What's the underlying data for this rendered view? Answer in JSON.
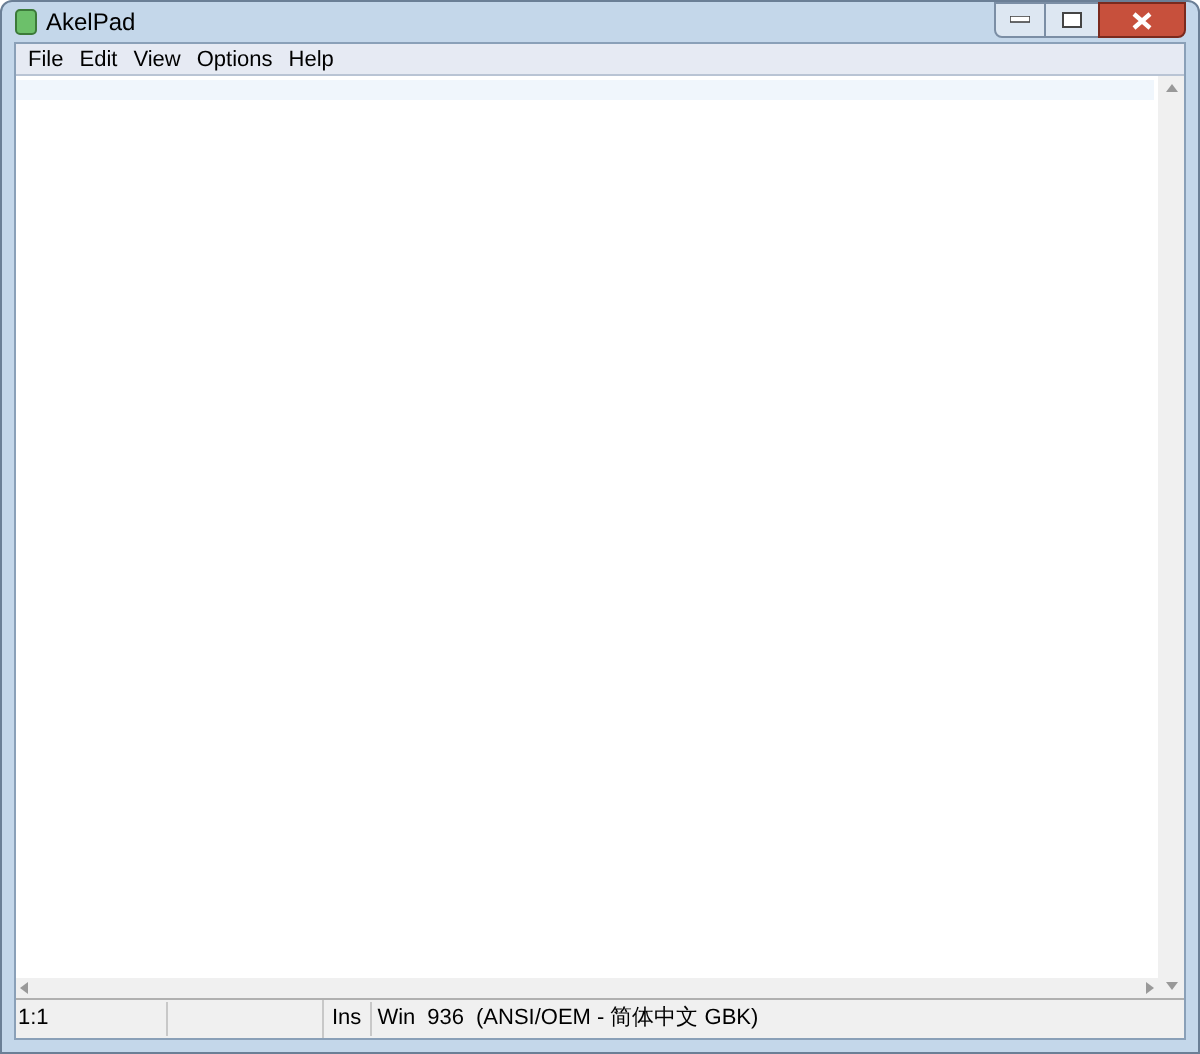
{
  "window": {
    "title": "AkelPad"
  },
  "menu": [
    "File",
    "Edit",
    "View",
    "Options",
    "Help"
  ],
  "status_bar": {
    "position": "1:1",
    "mode": "Ins",
    "encoding": [
      "Win",
      "936",
      "(ANSI/OEM - 简体中文 GBK)"
    ]
  }
}
